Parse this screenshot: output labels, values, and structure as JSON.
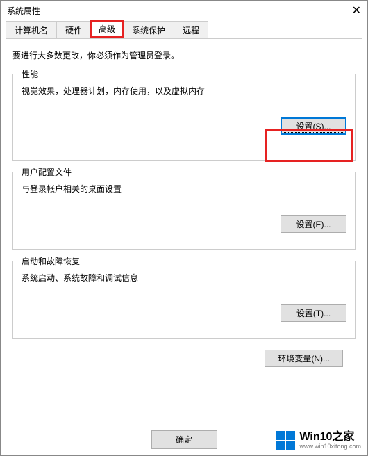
{
  "titlebar": {
    "title": "系统属性",
    "close": "✕"
  },
  "tabs": {
    "computer_name": "计算机名",
    "hardware": "硬件",
    "advanced": "高级",
    "system_protection": "系统保护",
    "remote": "远程"
  },
  "instruction": "要进行大多数更改，你必须作为管理员登录。",
  "performance": {
    "legend": "性能",
    "desc": "视觉效果，处理器计划，内存使用，以及虚拟内存",
    "button": "设置(S)..."
  },
  "user_profile": {
    "legend": "用户配置文件",
    "desc": "与登录帐户相关的桌面设置",
    "button": "设置(E)..."
  },
  "startup": {
    "legend": "启动和故障恢复",
    "desc": "系统启动、系统故障和调试信息",
    "button": "设置(T)..."
  },
  "env_button": "环境变量(N)...",
  "bottom": {
    "ok": "确定"
  },
  "watermark": {
    "main": "Win10之家",
    "sub": "www.win10xitong.com"
  }
}
